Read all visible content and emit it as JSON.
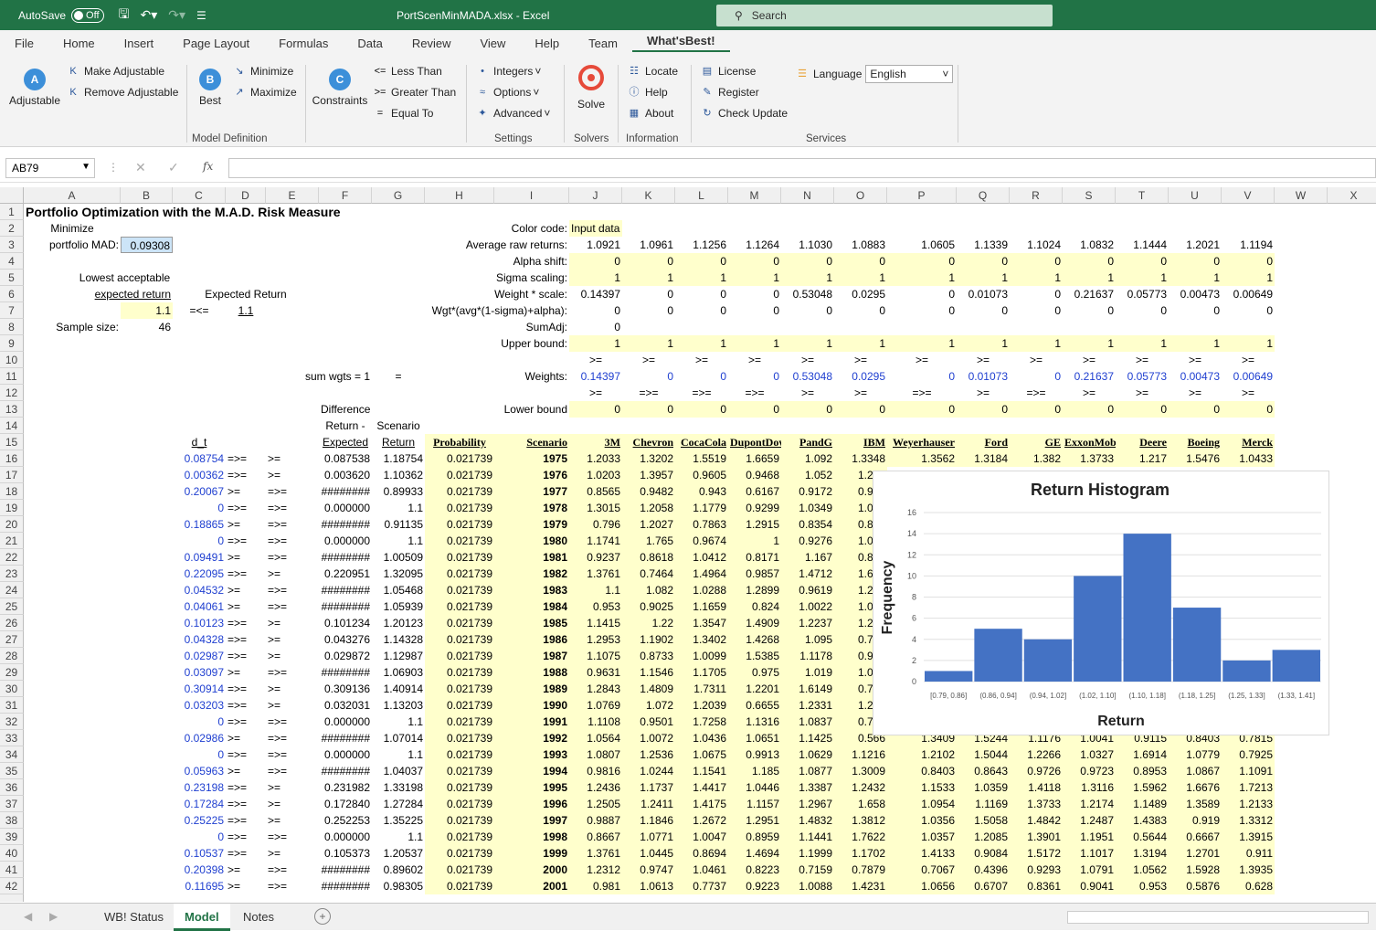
{
  "app": {
    "autosave": "AutoSave",
    "toggle": "Off",
    "title": "PortScenMinMADA.xlsx  -  Excel",
    "search": "Search"
  },
  "menu": [
    "File",
    "Home",
    "Insert",
    "Page Layout",
    "Formulas",
    "Data",
    "Review",
    "View",
    "Help",
    "Team",
    "What'sBest!"
  ],
  "ribbon": {
    "adjustable": "Adjustable",
    "make_adjustable": "Make Adjustable",
    "remove_adjustable": "Remove Adjustable",
    "best": "Best",
    "minimize": "Minimize",
    "maximize": "Maximize",
    "constraints": "Constraints",
    "less_than": "Less Than",
    "greater_than": "Greater Than",
    "equal_to": "Equal To",
    "integers": "Integers",
    "options": "Options",
    "advanced": "Advanced",
    "solve": "Solve",
    "locate": "Locate",
    "help": "Help",
    "about": "About",
    "license": "License",
    "register": "Register",
    "check_update": "Check Update",
    "language": "Language",
    "language_value": "English",
    "groups": {
      "model_definition": "Model Definition",
      "settings": "Settings",
      "solvers": "Solvers",
      "information": "Information",
      "services": "Services"
    }
  },
  "namebox": "AB79",
  "columns": [
    "A",
    "B",
    "C",
    "D",
    "E",
    "F",
    "G",
    "H",
    "I",
    "J",
    "K",
    "L",
    "M",
    "N",
    "O",
    "P",
    "Q",
    "R",
    "S",
    "T",
    "U",
    "V",
    "W",
    "X"
  ],
  "labels": {
    "title": "Portfolio Optimization with the M.A.D. Risk Measure",
    "minimize": "Minimize",
    "portfolio_mad": "portfolio MAD:",
    "mad_value": "0.09308",
    "lowest": "Lowest acceptable",
    "expected_return": "expected return",
    "expected_return2": "Expected Return",
    "req_ret": "1.1",
    "ltgt": "=<=",
    "exp_val": "1.1",
    "sample_size": "Sample size:",
    "sample_val": "46",
    "sum_wgts": "sum wgts = 1",
    "eq": "=",
    "color_code": "Color code:",
    "input_data": "Input data",
    "avg_raw": "Average raw returns:",
    "alpha_shift": "Alpha shift:",
    "sigma_scaling": "Sigma scaling:",
    "weight_scale": "Weight * scale:",
    "wgt_avg": "Wgt*(avg*(1-sigma)+alpha):",
    "sumadj": "SumAdj:",
    "sumadj_val": "0",
    "upper": "Upper bound:",
    "weights": "Weights:",
    "lower": "Lower bound",
    "difference": "Difference",
    "return_dash": "Return -",
    "scenario_lbl": "Scenario",
    "dt": "d_t",
    "expected": "Expected",
    "return": "Return",
    "probability": "Probability",
    "scenario": "Scenario"
  },
  "stocks": [
    "3M",
    "Chevron",
    "CocaCola",
    "DupontDow",
    "PandG",
    "IBM",
    "Weyerhauser",
    "Ford",
    "GE",
    "ExxonMobil",
    "Deere",
    "Boeing",
    "Merck"
  ],
  "avg_returns": [
    "1.0921",
    "1.0961",
    "1.1256",
    "1.1264",
    "1.1030",
    "1.0883",
    "1.0605",
    "1.1339",
    "1.1024",
    "1.0832",
    "1.1444",
    "1.2021",
    "1.1194"
  ],
  "alpha": [
    "0",
    "0",
    "0",
    "0",
    "0",
    "0",
    "0",
    "0",
    "0",
    "0",
    "0",
    "0",
    "0"
  ],
  "sigma": [
    "1",
    "1",
    "1",
    "1",
    "1",
    "1",
    "1",
    "1",
    "1",
    "1",
    "1",
    "1",
    "1"
  ],
  "wscale": [
    "0.14397",
    "0",
    "0",
    "0",
    "0.53048",
    "0.0295",
    "0",
    "0.01073",
    "0",
    "0.21637",
    "0.05773",
    "0.00473",
    "0.00649"
  ],
  "wgtavg": [
    "0",
    "0",
    "0",
    "0",
    "0",
    "0",
    "0",
    "0",
    "0",
    "0",
    "0",
    "0",
    "0"
  ],
  "upper": [
    "1",
    "1",
    "1",
    "1",
    "1",
    "1",
    "1",
    "1",
    "1",
    "1",
    "1",
    "1",
    "1"
  ],
  "row10": [
    ">=",
    ">=",
    ">=",
    ">=",
    ">=",
    ">=",
    ">=",
    ">=",
    ">=",
    ">=",
    ">=",
    ">=",
    ">="
  ],
  "weights": [
    "0.14397",
    "0",
    "0",
    "0",
    "0.53048",
    "0.0295",
    "0",
    "0.01073",
    "0",
    "0.21637",
    "0.05773",
    "0.00473",
    "0.00649"
  ],
  "row12": [
    ">=",
    "=>=",
    "=>=",
    "=>=",
    ">=",
    ">=",
    "=>=",
    ">=",
    "=>=",
    ">=",
    ">=",
    ">=",
    ">="
  ],
  "lower": [
    "0",
    "0",
    "0",
    "0",
    "0",
    "0",
    "0",
    "0",
    "0",
    "0",
    "0",
    "0",
    "0"
  ],
  "rows": [
    {
      "n": "16",
      "dt": "0.08754",
      "d": "=>=",
      "e": ">=",
      "f": "0.087538",
      "g": "1.18754",
      "h": "0.021739",
      "i": "1975",
      "v": [
        "1.2033",
        "1.3202",
        "1.5519",
        "1.6659",
        "1.092",
        "1.3348",
        "1.3562",
        "1.3184",
        "1.382",
        "1.3733",
        "1.217",
        "1.5476",
        "1.0433"
      ]
    },
    {
      "n": "17",
      "dt": "0.00362",
      "d": "=>=",
      "e": ">=",
      "f": "0.003620",
      "g": "1.10362",
      "h": "0.021739",
      "i": "1976",
      "v": [
        "1.0203",
        "1.3957",
        "0.9605",
        "0.9468",
        "1.052",
        "1.244",
        "",
        "",
        "",
        "",
        "",
        "",
        ""
      ]
    },
    {
      "n": "18",
      "dt": "0.20067",
      "d": ">=",
      "e": "=>=",
      "f": "########",
      "g": "0.89933",
      "h": "0.021739",
      "i": "1977",
      "v": [
        "0.8565",
        "0.9482",
        "0.943",
        "0.6167",
        "0.9172",
        "0.979",
        "",
        "",
        "",
        "",
        "",
        "",
        ""
      ]
    },
    {
      "n": "19",
      "dt": "0",
      "d": "=>=",
      "e": "=>=",
      "f": "0.000000",
      "g": "1.1",
      "h": "0.021739",
      "i": "1978",
      "v": [
        "1.3015",
        "1.2058",
        "1.1779",
        "0.9299",
        "1.0349",
        "1.091",
        "",
        "",
        "",
        "",
        "",
        "",
        ""
      ]
    },
    {
      "n": "20",
      "dt": "0.18865",
      "d": ">=",
      "e": "=>=",
      "f": "########",
      "g": "0.91135",
      "h": "0.021739",
      "i": "1979",
      "v": [
        "0.796",
        "1.2027",
        "0.7863",
        "1.2915",
        "0.8354",
        "0.862",
        "",
        "",
        "",
        "",
        "",
        "",
        ""
      ]
    },
    {
      "n": "21",
      "dt": "0",
      "d": "=>=",
      "e": "=>=",
      "f": "0.000000",
      "g": "1.1",
      "h": "0.021739",
      "i": "1980",
      "v": [
        "1.1741",
        "1.765",
        "0.9674",
        "1",
        "0.9276",
        "1.054",
        "",
        "",
        "",
        "",
        "",
        "",
        ""
      ]
    },
    {
      "n": "22",
      "dt": "0.09491",
      "d": ">=",
      "e": "=>=",
      "f": "########",
      "g": "1.00509",
      "h": "0.021739",
      "i": "1981",
      "v": [
        "0.9237",
        "0.8618",
        "1.0412",
        "0.8171",
        "1.167",
        "0.837",
        "",
        "",
        "",
        "",
        "",
        "",
        ""
      ]
    },
    {
      "n": "23",
      "dt": "0.22095",
      "d": "=>=",
      "e": ">=",
      "f": "0.220951",
      "g": "1.32095",
      "h": "0.021739",
      "i": "1982",
      "v": [
        "1.3761",
        "0.7464",
        "1.4964",
        "0.9857",
        "1.4712",
        "1.692",
        "",
        "",
        "",
        "",
        "",
        "",
        ""
      ]
    },
    {
      "n": "24",
      "dt": "0.04532",
      "d": ">=",
      "e": "=>=",
      "f": "########",
      "g": "1.05468",
      "h": "0.021739",
      "i": "1983",
      "v": [
        "1.1",
        "1.082",
        "1.0288",
        "1.2899",
        "0.9619",
        "1.267",
        "",
        "",
        "",
        "",
        "",
        "",
        ""
      ]
    },
    {
      "n": "25",
      "dt": "0.04061",
      "d": ">=",
      "e": "=>=",
      "f": "########",
      "g": "1.05939",
      "h": "0.021739",
      "i": "1984",
      "v": [
        "0.953",
        "0.9025",
        "1.1659",
        "0.824",
        "1.0022",
        "1.009",
        "",
        "",
        "",
        "",
        "",
        "",
        ""
      ]
    },
    {
      "n": "26",
      "dt": "0.10123",
      "d": "=>=",
      "e": ">=",
      "f": "0.101234",
      "g": "1.20123",
      "h": "0.021739",
      "i": "1985",
      "v": [
        "1.1415",
        "1.22",
        "1.3547",
        "1.4909",
        "1.2237",
        "1.262",
        "",
        "",
        "",
        "",
        "",
        "",
        ""
      ]
    },
    {
      "n": "27",
      "dt": "0.04328",
      "d": "=>=",
      "e": ">=",
      "f": "0.043276",
      "g": "1.14328",
      "h": "0.021739",
      "i": "1986",
      "v": [
        "1.2953",
        "1.1902",
        "1.3402",
        "1.4268",
        "1.095",
        "0.771",
        "",
        "",
        "",
        "",
        "",
        "",
        ""
      ]
    },
    {
      "n": "28",
      "dt": "0.02987",
      "d": "=>=",
      "e": ">=",
      "f": "0.029872",
      "g": "1.12987",
      "h": "0.021739",
      "i": "1987",
      "v": [
        "1.1075",
        "0.8733",
        "1.0099",
        "1.5385",
        "1.1178",
        "0.962",
        "",
        "",
        "",
        "",
        "",
        "",
        ""
      ]
    },
    {
      "n": "29",
      "dt": "0.03097",
      "d": ">=",
      "e": "=>=",
      "f": "########",
      "g": "1.06903",
      "h": "0.021739",
      "i": "1988",
      "v": [
        "0.9631",
        "1.1546",
        "1.1705",
        "0.975",
        "1.019",
        "1.055",
        "",
        "",
        "",
        "",
        "",
        "",
        ""
      ]
    },
    {
      "n": "30",
      "dt": "0.30914",
      "d": "=>=",
      "e": ">=",
      "f": "0.309136",
      "g": "1.40914",
      "h": "0.021739",
      "i": "1989",
      "v": [
        "1.2843",
        "1.4809",
        "1.7311",
        "1.2201",
        "1.6149",
        "0.772",
        "",
        "",
        "",
        "",
        "",
        "",
        ""
      ]
    },
    {
      "n": "31",
      "dt": "0.03203",
      "d": "=>=",
      "e": ">=",
      "f": "0.032031",
      "g": "1.13203",
      "h": "0.021739",
      "i": "1990",
      "v": [
        "1.0769",
        "1.072",
        "1.2039",
        "0.6655",
        "1.2331",
        "1.200",
        "",
        "",
        "",
        "",
        "",
        "",
        ""
      ]
    },
    {
      "n": "32",
      "dt": "0",
      "d": "=>=",
      "e": "=>=",
      "f": "0.000000",
      "g": "1.1",
      "h": "0.021739",
      "i": "1991",
      "v": [
        "1.1108",
        "0.9501",
        "1.7258",
        "1.1316",
        "1.0837",
        "0.787",
        "",
        "",
        "",
        "",
        "",
        "",
        ""
      ]
    },
    {
      "n": "33",
      "dt": "0.02986",
      "d": ">=",
      "e": "=>=",
      "f": "########",
      "g": "1.07014",
      "h": "0.021739",
      "i": "1992",
      "v": [
        "1.0564",
        "1.0072",
        "1.0436",
        "1.0651",
        "1.1425",
        "0.566",
        "1.3409",
        "1.5244",
        "1.1176",
        "1.0041",
        "0.9115",
        "0.8403",
        "0.7815"
      ]
    },
    {
      "n": "34",
      "dt": "0",
      "d": "=>=",
      "e": "=>=",
      "f": "0.000000",
      "g": "1.1",
      "h": "0.021739",
      "i": "1993",
      "v": [
        "1.0807",
        "1.2536",
        "1.0675",
        "0.9913",
        "1.0629",
        "1.1216",
        "1.2102",
        "1.5044",
        "1.2266",
        "1.0327",
        "1.6914",
        "1.0779",
        "0.7925"
      ]
    },
    {
      "n": "35",
      "dt": "0.05963",
      "d": ">=",
      "e": "=>=",
      "f": "########",
      "g": "1.04037",
      "h": "0.021739",
      "i": "1994",
      "v": [
        "0.9816",
        "1.0244",
        "1.1541",
        "1.185",
        "1.0877",
        "1.3009",
        "0.8403",
        "0.8643",
        "0.9726",
        "0.9723",
        "0.8953",
        "1.0867",
        "1.1091"
      ]
    },
    {
      "n": "36",
      "dt": "0.23198",
      "d": "=>=",
      "e": ">=",
      "f": "0.231982",
      "g": "1.33198",
      "h": "0.021739",
      "i": "1995",
      "v": [
        "1.2436",
        "1.1737",
        "1.4417",
        "1.0446",
        "1.3387",
        "1.2432",
        "1.1533",
        "1.0359",
        "1.4118",
        "1.3116",
        "1.5962",
        "1.6676",
        "1.7213"
      ]
    },
    {
      "n": "37",
      "dt": "0.17284",
      "d": "=>=",
      "e": ">=",
      "f": "0.172840",
      "g": "1.27284",
      "h": "0.021739",
      "i": "1996",
      "v": [
        "1.2505",
        "1.2411",
        "1.4175",
        "1.1157",
        "1.2967",
        "1.658",
        "1.0954",
        "1.1169",
        "1.3733",
        "1.2174",
        "1.1489",
        "1.3589",
        "1.2133"
      ]
    },
    {
      "n": "38",
      "dt": "0.25225",
      "d": "=>=",
      "e": ">=",
      "f": "0.252253",
      "g": "1.35225",
      "h": "0.021739",
      "i": "1997",
      "v": [
        "0.9887",
        "1.1846",
        "1.2672",
        "1.2951",
        "1.4832",
        "1.3812",
        "1.0356",
        "1.5058",
        "1.4842",
        "1.2487",
        "1.4383",
        "0.919",
        "1.3312"
      ]
    },
    {
      "n": "39",
      "dt": "0",
      "d": "=>=",
      "e": "=>=",
      "f": "0.000000",
      "g": "1.1",
      "h": "0.021739",
      "i": "1998",
      "v": [
        "0.8667",
        "1.0771",
        "1.0047",
        "0.8959",
        "1.1441",
        "1.7622",
        "1.0357",
        "1.2085",
        "1.3901",
        "1.1951",
        "0.5644",
        "0.6667",
        "1.3915"
      ]
    },
    {
      "n": "40",
      "dt": "0.10537",
      "d": "=>=",
      "e": ">=",
      "f": "0.105373",
      "g": "1.20537",
      "h": "0.021739",
      "i": "1999",
      "v": [
        "1.3761",
        "1.0445",
        "0.8694",
        "1.4694",
        "1.1999",
        "1.1702",
        "1.4133",
        "0.9084",
        "1.5172",
        "1.1017",
        "1.3194",
        "1.2701",
        "0.911"
      ]
    },
    {
      "n": "41",
      "dt": "0.20398",
      "d": ">=",
      "e": "=>=",
      "f": "########",
      "g": "0.89602",
      "h": "0.021739",
      "i": "2000",
      "v": [
        "1.2312",
        "0.9747",
        "1.0461",
        "0.8223",
        "0.7159",
        "0.7879",
        "0.7067",
        "0.4396",
        "0.9293",
        "1.0791",
        "1.0562",
        "1.5928",
        "1.3935"
      ]
    },
    {
      "n": "42",
      "dt": "0.11695",
      "d": ">=",
      "e": "=>=",
      "f": "########",
      "g": "0.98305",
      "h": "0.021739",
      "i": "2001",
      "v": [
        "0.981",
        "1.0613",
        "0.7737",
        "0.9223",
        "1.0088",
        "1.4231",
        "1.0656",
        "0.6707",
        "0.8361",
        "0.9041",
        "0.953",
        "0.5876",
        "0.628"
      ]
    }
  ],
  "chart_data": {
    "type": "bar",
    "title": "Return Histogram",
    "xlabel": "Return",
    "ylabel": "Frequency",
    "categories": [
      "[0.79, 0.86]",
      "(0.86, 0.94]",
      "(0.94, 1.02]",
      "(1.02, 1.10]",
      "(1.10, 1.18]",
      "(1.18, 1.25]",
      "(1.25, 1.33]",
      "(1.33, 1.41]"
    ],
    "values": [
      1,
      5,
      4,
      10,
      14,
      7,
      2,
      3
    ],
    "ylim": [
      0,
      16
    ],
    "yticks": [
      "0",
      "2",
      "4",
      "6",
      "8",
      "10",
      "12",
      "14",
      "16"
    ],
    "color": "#4472c4"
  },
  "sheets": {
    "status": "WB! Status",
    "model": "Model",
    "notes": "Notes"
  }
}
